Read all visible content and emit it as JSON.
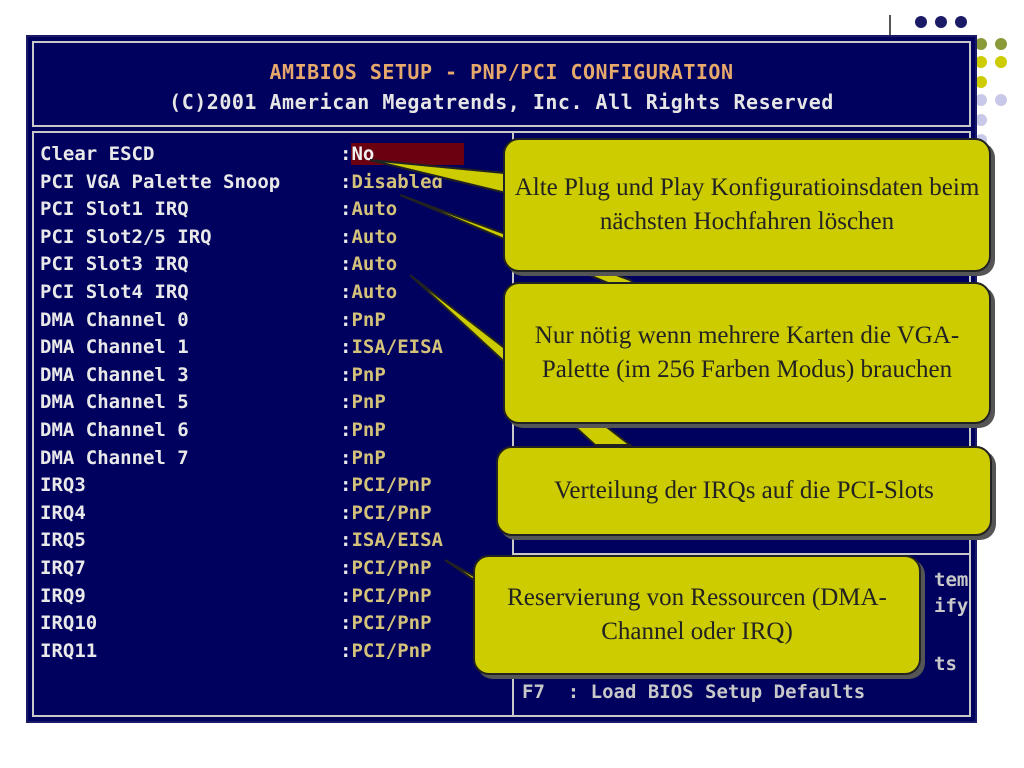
{
  "header": {
    "title": "AMIBIOS SETUP - PNP/PCI CONFIGURATION",
    "copyright": "(C)2001 American Megatrends, Inc. All Rights Reserved"
  },
  "settings": [
    {
      "name": "Clear ESCD",
      "value": "No"
    },
    {
      "name": "PCI VGA Palette Snoop",
      "value": "Disabled"
    },
    {
      "name": "PCI Slot1 IRQ",
      "value": "Auto"
    },
    {
      "name": "PCI Slot2/5 IRQ",
      "value": "Auto"
    },
    {
      "name": "PCI Slot3 IRQ",
      "value": "Auto"
    },
    {
      "name": "PCI Slot4 IRQ",
      "value": "Auto"
    },
    {
      "name": "DMA Channel 0",
      "value": "PnP"
    },
    {
      "name": "DMA Channel 1",
      "value": "ISA/EISA"
    },
    {
      "name": "DMA Channel 3",
      "value": "PnP"
    },
    {
      "name": "DMA Channel 5",
      "value": "PnP"
    },
    {
      "name": "DMA Channel 6",
      "value": "PnP"
    },
    {
      "name": "DMA Channel 7",
      "value": "PnP"
    },
    {
      "name": "IRQ3",
      "value": "PCI/PnP"
    },
    {
      "name": "IRQ4",
      "value": "PCI/PnP"
    },
    {
      "name": "IRQ5",
      "value": "ISA/EISA"
    },
    {
      "name": "IRQ7",
      "value": "PCI/PnP"
    },
    {
      "name": "IRQ9",
      "value": "PCI/PnP"
    },
    {
      "name": "IRQ10",
      "value": "PCI/PnP"
    },
    {
      "name": "IRQ11",
      "value": "PCI/PnP"
    }
  ],
  "help_fragments": {
    "line1": "tem",
    "line2": "ify",
    "line3": "ts",
    "f7": "F7  : Load BIOS Setup Defaults"
  },
  "callouts": {
    "escd": "Alte Plug und Play Konfiguratioinsdaten beim nächsten Hochfahren löschen",
    "vga": "Nur nötig wenn mehrere Karten die VGA-Palette (im 256 Farben Modus) brauchen",
    "irq": "Verteilung der IRQs auf die PCI-Slots",
    "reserve": "Reservierung von Ressourcen (DMA-Channel oder IRQ)"
  },
  "colors": {
    "bios_bg": "#00005e",
    "value_text": "#d4c27a",
    "selected_bg": "#6a0010",
    "callout_bg": "#cccc00",
    "dot_dark": "#1a1a66",
    "dot_olive": "#8a9a3a",
    "dot_yellow": "#cccc00",
    "dot_lavender": "#c8c8e8"
  }
}
